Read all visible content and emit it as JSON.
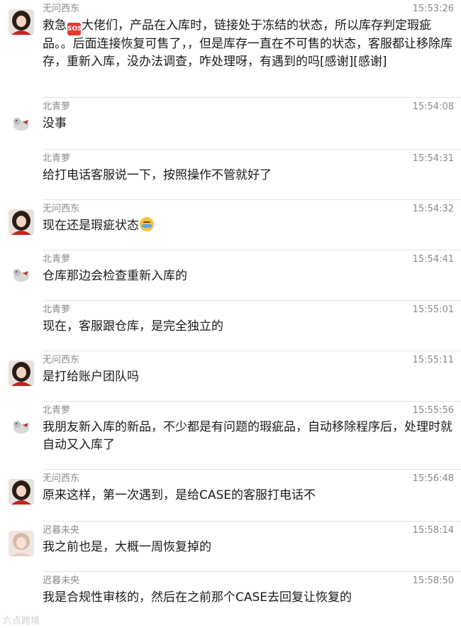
{
  "messages": [
    {
      "sender": "无问西东",
      "avatar": "woman-avatar",
      "time": "15:53:26",
      "text_parts": [
        "救急",
        "大佬们，产品在入库时，链接处于冻结的状态，所以库存判定瑕疵品。。后面连接恢复可售了，，但是库存一直在不可售的状态，客服都让移除库存，重新入库，没办法调查，咋处理呀，有遇到的吗[感谢][感谢]"
      ],
      "sos_label": "SOS"
    },
    {
      "sender": "北青萝",
      "avatar": "dog-avatar",
      "time": "15:54:08",
      "text": "没事"
    },
    {
      "sender": "北青萝",
      "avatar": "none",
      "time": "15:54:31",
      "text": "给打电话客服说一下，按照操作不管就好了"
    },
    {
      "sender": "无问西东",
      "avatar": "woman-avatar",
      "time": "15:54:32",
      "text": "现在还是瑕疵状态"
    },
    {
      "sender": "北青萝",
      "avatar": "dog-avatar",
      "time": "15:54:41",
      "text": "仓库那边会检查重新入库的"
    },
    {
      "sender": "北青萝",
      "avatar": "none",
      "time": "15:55:01",
      "text": "现在，客服跟仓库，是完全独立的"
    },
    {
      "sender": "无问西东",
      "avatar": "woman-avatar",
      "time": "15:55:11",
      "text": "是打给账户团队吗"
    },
    {
      "sender": "北青萝",
      "avatar": "dog-avatar",
      "time": "15:55:56",
      "text": "我朋友新入库的新品，不少都是有问题的瑕疵品，自动移除程序后，处理时就自动又入库了"
    },
    {
      "sender": "无问西东",
      "avatar": "woman-avatar",
      "time": "15:56:48",
      "text": "原来这样，第一次遇到，是给CASE的客服打电话不"
    },
    {
      "sender": "迟暮未央",
      "avatar": "girl-avatar",
      "time": "15:58:14",
      "text": "我之前也是，大概一周恢复掉的"
    },
    {
      "sender": "迟暮未央",
      "avatar": "none",
      "time": "15:58:50",
      "text": "我是合规性审核的，然后在之前那个CASE去回复让恢复的"
    }
  ],
  "watermark": "六点跨境"
}
